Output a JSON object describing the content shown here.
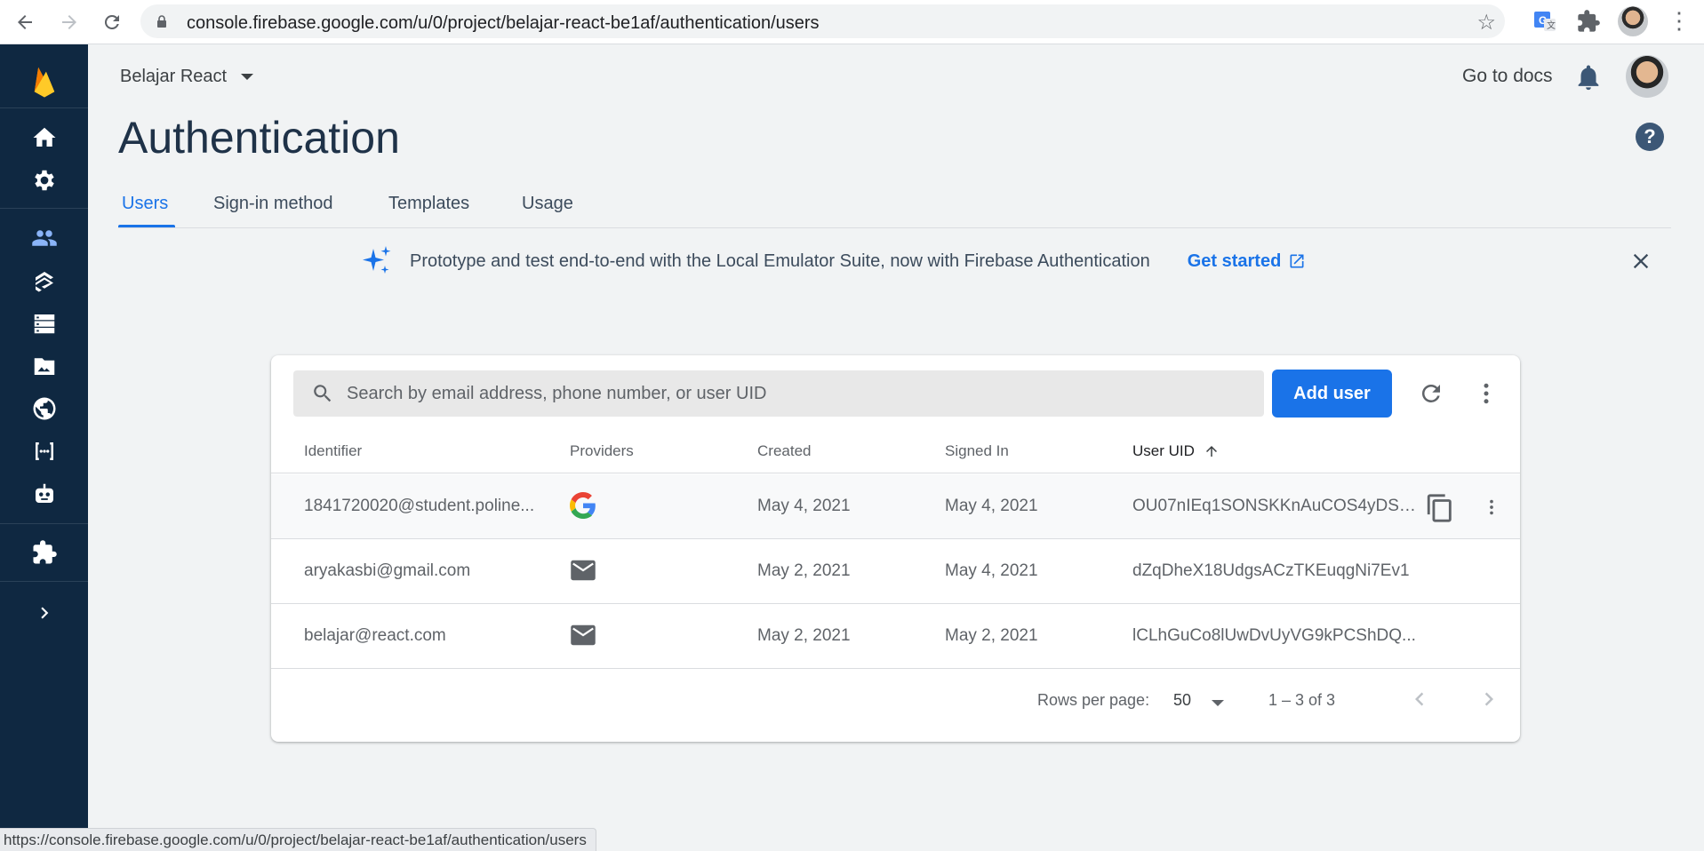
{
  "browser": {
    "url": "console.firebase.google.com/u/0/project/belajar-react-be1af/authentication/users",
    "status_url": "https://console.firebase.google.com/u/0/project/belajar-react-be1af/authentication/users"
  },
  "sidebar": {
    "items": [
      {
        "icon": "home-icon"
      },
      {
        "icon": "gear-icon"
      },
      {
        "icon": "people-icon",
        "active": true
      },
      {
        "icon": "firestore-icon"
      },
      {
        "icon": "database-icon"
      },
      {
        "icon": "storage-icon"
      },
      {
        "icon": "globe-icon"
      },
      {
        "icon": "functions-icon"
      },
      {
        "icon": "ml-robot-icon"
      },
      {
        "icon": "extensions-icon"
      },
      {
        "icon": "chevron-right-icon"
      }
    ]
  },
  "header": {
    "project_name": "Belajar React",
    "go_to_docs": "Go to docs",
    "page_title": "Authentication"
  },
  "tabs": [
    {
      "label": "Users",
      "active": true
    },
    {
      "label": "Sign-in method"
    },
    {
      "label": "Templates"
    },
    {
      "label": "Usage"
    }
  ],
  "banner": {
    "message": "Prototype and test end-to-end with the Local Emulator Suite, now with Firebase Authentication",
    "cta": "Get started"
  },
  "users_table": {
    "search_placeholder": "Search by email address, phone number, or user UID",
    "add_user_label": "Add user",
    "columns": [
      "Identifier",
      "Providers",
      "Created",
      "Signed In",
      "User UID"
    ],
    "rows": [
      {
        "identifier": "1841720020@student.poline...",
        "provider": "google",
        "created": "May 4, 2021",
        "signed_in": "May 4, 2021",
        "uid": "OU07nIEq1SONSKKnAuCOS4yDS8..."
      },
      {
        "identifier": "aryakasbi@gmail.com",
        "provider": "email",
        "created": "May 2, 2021",
        "signed_in": "May 4, 2021",
        "uid": "dZqDheX18UdgsACzTKEuqgNi7Ev1"
      },
      {
        "identifier": "belajar@react.com",
        "provider": "email",
        "created": "May 2, 2021",
        "signed_in": "May 2, 2021",
        "uid": "lCLhGuCo8lUwDvUyVG9kPCShDQ..."
      }
    ],
    "pagination": {
      "rows_per_page_label": "Rows per page:",
      "rows_per_page": "50",
      "range": "1 – 3 of 3"
    }
  },
  "colors": {
    "accent": "#1a73e8",
    "sidebar": "#0f2841",
    "title": "#1f3248"
  }
}
